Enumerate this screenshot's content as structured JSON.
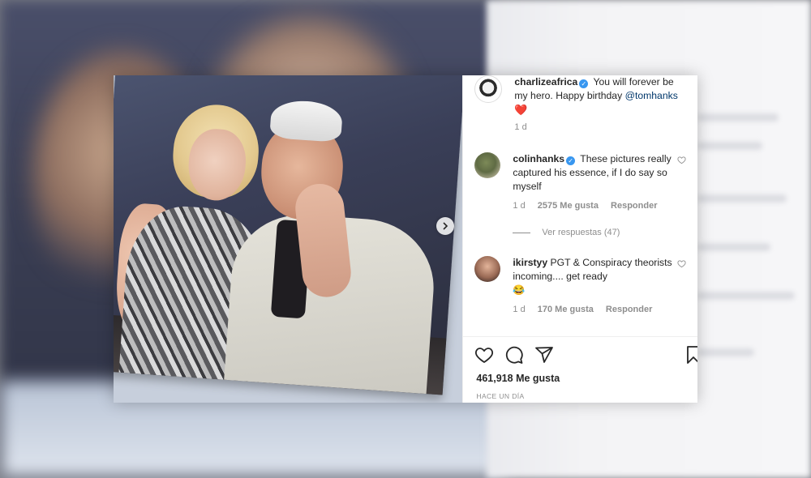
{
  "post": {
    "author": {
      "username": "charlizeafrica",
      "caption_text": "You will forever be my hero. Happy birthday",
      "mention": "@tomhanks",
      "emoji": "❤️",
      "time": "1 d"
    },
    "comments": [
      {
        "username": "colinhanks",
        "text": "These pictures really captured his essence, if I do say so myself",
        "time": "1 d",
        "likes": "2575 Me gusta",
        "reply_label": "Responder",
        "view_replies": "Ver respuestas (47)"
      },
      {
        "username": "ikirstyy",
        "text": "PGT & Conspiracy theorists incoming.... get ready",
        "emoji": "😂",
        "time": "1 d",
        "likes": "170 Me gusta",
        "reply_label": "Responder"
      }
    ],
    "like_count": "461,918 Me gusta",
    "posted_ago": "HACE UN DÍA"
  },
  "colors": {
    "verified": "#3897f0",
    "mention": "#00376b",
    "text": "#262626",
    "muted": "#8e8e8e",
    "heart": "#ed4956"
  },
  "icons": [
    "heart-icon",
    "comment-icon",
    "share-icon",
    "bookmark-icon",
    "chevron-right-icon",
    "verified-badge-icon"
  ]
}
